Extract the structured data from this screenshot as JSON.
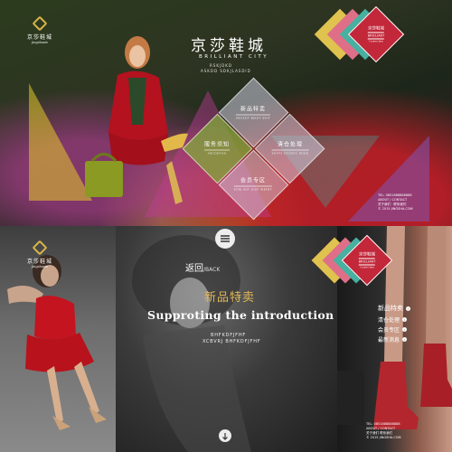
{
  "top": {
    "logo": {
      "cn": "京莎鞋城",
      "en": "jingshaxie"
    },
    "brand": {
      "cn": "京莎鞋城",
      "en": "BRILLIANT CITY",
      "sub1": "RSKJDKD",
      "sub2": "ASKDD SDKJLASDID"
    },
    "corner_badge": {
      "cn": "京莎鞋城",
      "en": "BRICLIANT",
      "sub": "f ynms lers"
    },
    "menu": [
      {
        "cn": "新品特卖",
        "en": "ABUKDF BJKDF BAIF"
      },
      {
        "cn": "服务须知",
        "en": "ABCDEFGH"
      },
      {
        "cn": "清仓处理",
        "en": "SDFFS DFSDFG RDDE"
      },
      {
        "cn": "会员专区",
        "en": "KFBJ SDF JKDF WEFBF"
      }
    ],
    "contact": {
      "tel": "TEL: 0851888888888",
      "about": "ABOUT / CONTACT",
      "links": "关于我们 · 联系我们",
      "copy": "© 2015 JINGSHA.COM"
    }
  },
  "bottom_left": {
    "logo": {
      "cn": "京莎鞋城",
      "en": "jingshaxie"
    }
  },
  "bottom_middle": {
    "back_cn": "返回",
    "back_en": "/BACK",
    "title_cn": "新品特卖",
    "title_en": "Supproting the introduction",
    "sub1": "BHFKDFJFHF",
    "sub2": "XCBVRJ BHFKDFJFHF"
  },
  "bottom_right": {
    "corner_badge": {
      "cn": "京莎鞋城",
      "en": "BRICLIANT",
      "sub": "f ynms lers"
    },
    "nav": [
      {
        "label": "新品特卖"
      },
      {
        "label": "清仓处理"
      },
      {
        "label": "会员专区"
      },
      {
        "label": "最新消息"
      }
    ],
    "contact": {
      "tel": "TEL: 0851888888888",
      "about": "ABOUT / CONTACT",
      "links": "关于我们 联系我们",
      "copy": "© 2015 JINGSHA.COM"
    }
  },
  "colors": {
    "gold": "#d9b44a",
    "pink": "#d9667e",
    "teal": "#3fa99b",
    "purple": "#8b5aa8",
    "red": "#c0222e"
  }
}
